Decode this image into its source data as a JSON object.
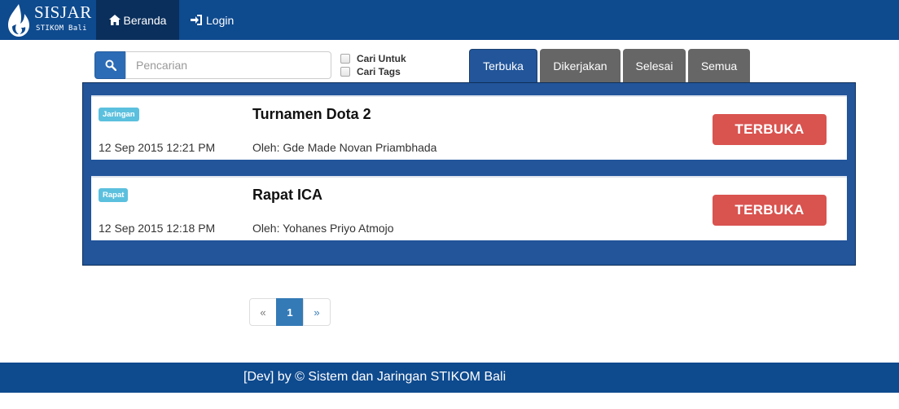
{
  "navbar": {
    "brand_name": "SISJAR",
    "brand_sub": "STIKOM Bali",
    "items": [
      {
        "label": "Beranda",
        "icon": "home-icon"
      },
      {
        "label": "Login",
        "icon": "login-icon"
      }
    ]
  },
  "search": {
    "placeholder": "Pencarian",
    "value": "",
    "options": [
      {
        "label": "Cari Untuk",
        "checked": false
      },
      {
        "label": "Cari Tags",
        "checked": false
      }
    ]
  },
  "tabs": [
    {
      "label": "Terbuka",
      "active": true
    },
    {
      "label": "Dikerjakan",
      "active": false
    },
    {
      "label": "Selesai",
      "active": false
    },
    {
      "label": "Semua",
      "active": false
    }
  ],
  "tasks": [
    {
      "badge": "Jaringan",
      "title": "Turnamen Dota 2",
      "date": "12 Sep 2015 12:21 PM",
      "author": "Oleh: Gde Made Novan Priambhada",
      "status": "TERBUKA"
    },
    {
      "badge": "Rapat",
      "title": "Rapat ICA",
      "date": "12 Sep 2015 12:18 PM",
      "author": "Oleh: Yohanes Priyo Atmojo",
      "status": "TERBUKA"
    }
  ],
  "pagination": {
    "prev": "«",
    "current": "1",
    "next": "»"
  },
  "footer": {
    "text": "[Dev] by © Sistem dan Jaringan STIKOM Bali"
  },
  "colors": {
    "navbar": "#0e4a8e",
    "active_nav": "#0a2f5c",
    "panel": "#22559a",
    "tab_inactive": "#666666",
    "badge": "#5bc0de",
    "status_open": "#d9534f",
    "pagination_active": "#337ab7"
  }
}
